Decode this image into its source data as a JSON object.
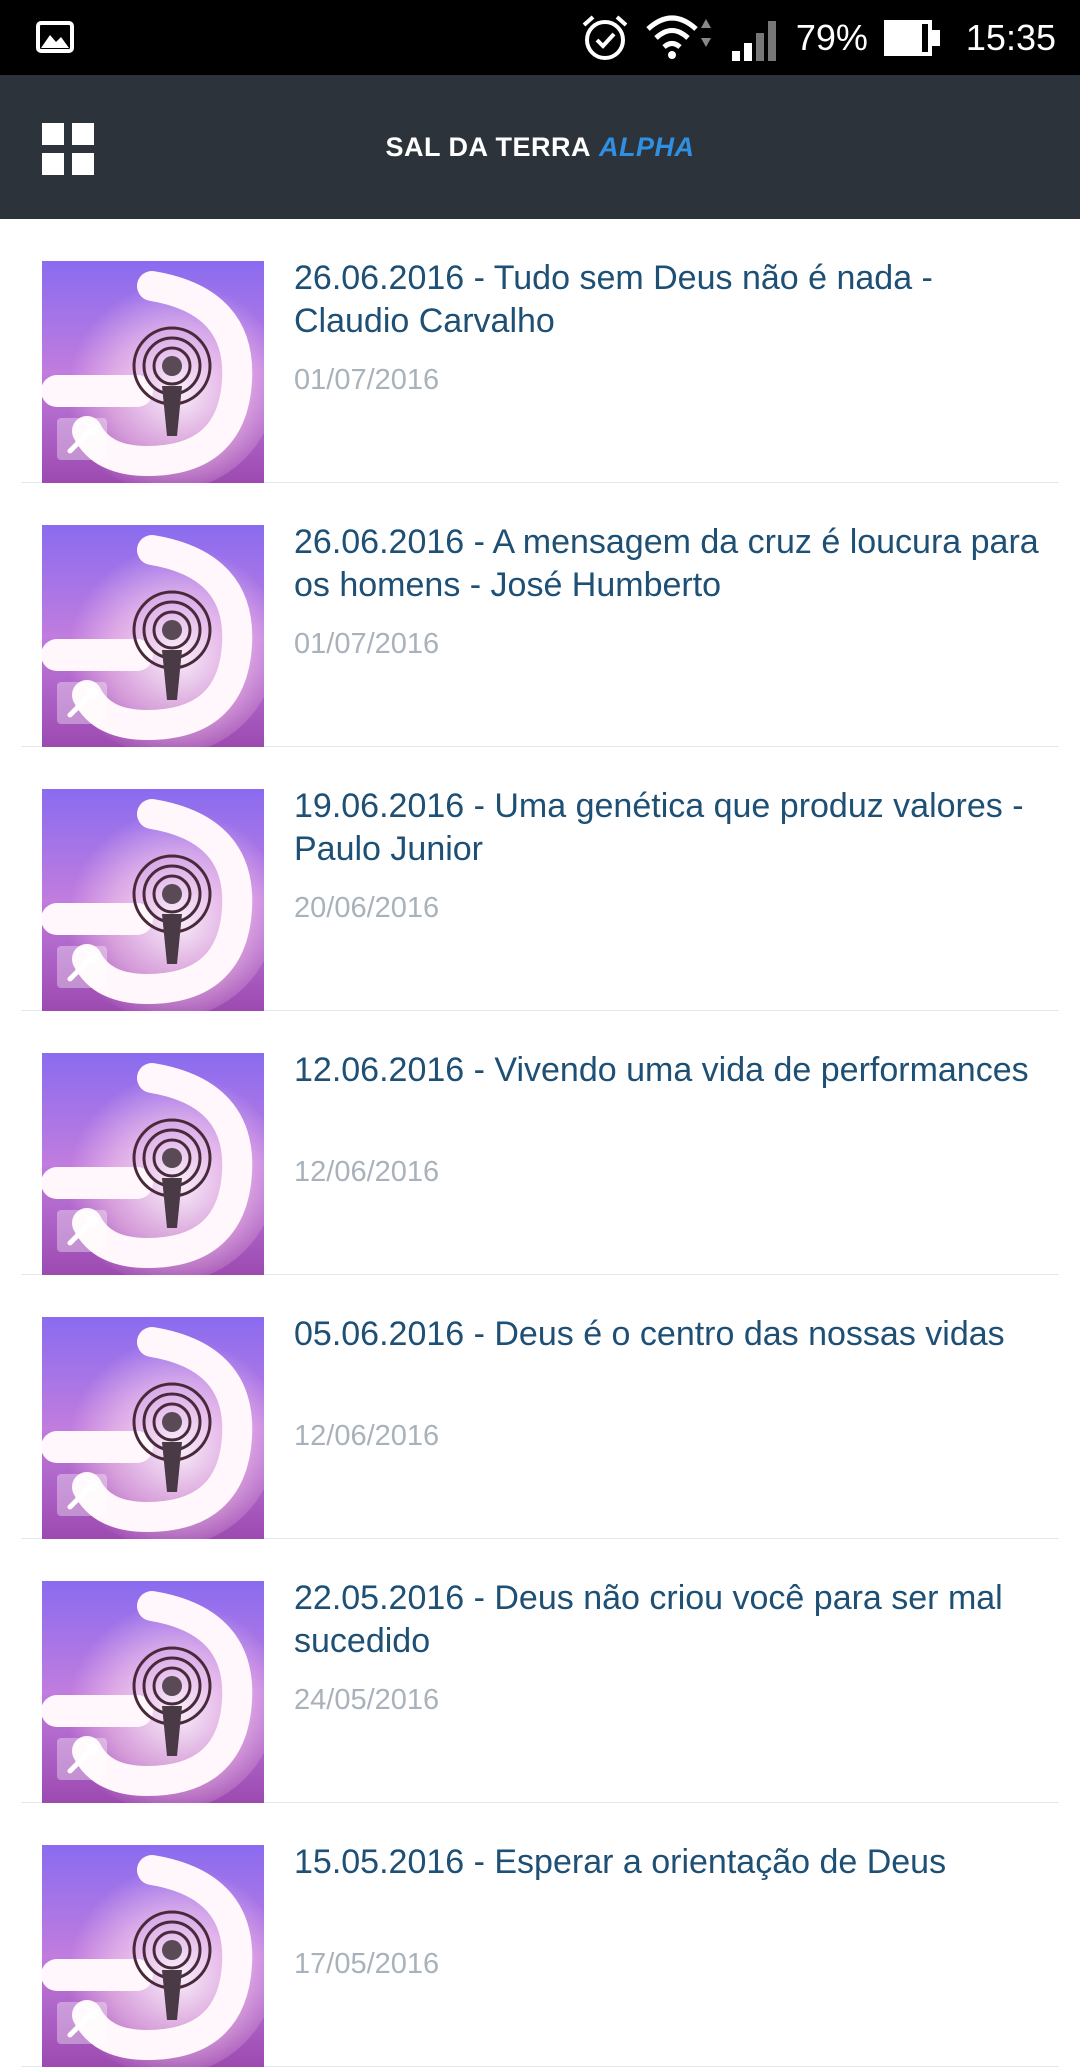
{
  "status_bar": {
    "icons": [
      "gallery-icon",
      "alarm-icon",
      "wifi-icon",
      "signal-icon",
      "battery-icon"
    ],
    "battery": "79%",
    "time": "15:35"
  },
  "app_bar": {
    "menu_icon": "grid-menu-icon",
    "title_main": "SAL DA TERRA",
    "title_accent": "ALPHA",
    "title_accent_color": "#2f8fe0",
    "background_color": "#2d333b"
  },
  "colors": {
    "title_text": "#1e4f74",
    "date_text": "#a9b2bb"
  },
  "items": [
    {
      "title": "26.06.2016 - Tudo sem Deus não é nada - Claudio Carvalho",
      "date": "01/07/2016"
    },
    {
      "title": "26.06.2016 - A mensagem da cruz é loucura para os homens - José Humberto",
      "date": "01/07/2016"
    },
    {
      "title": "19.06.2016 - Uma genética que produz valores - Paulo Junior",
      "date": "20/06/2016"
    },
    {
      "title": "12.06.2016 - Vivendo uma vida de performances",
      "date": "12/06/2016"
    },
    {
      "title": "05.06.2016 - Deus é o centro das nossas vidas",
      "date": "12/06/2016"
    },
    {
      "title": "22.05.2016 - Deus não criou você para ser mal sucedido",
      "date": "24/05/2016"
    },
    {
      "title": "15.05.2016 - Esperar a orientação de Deus",
      "date": "17/05/2016"
    }
  ]
}
